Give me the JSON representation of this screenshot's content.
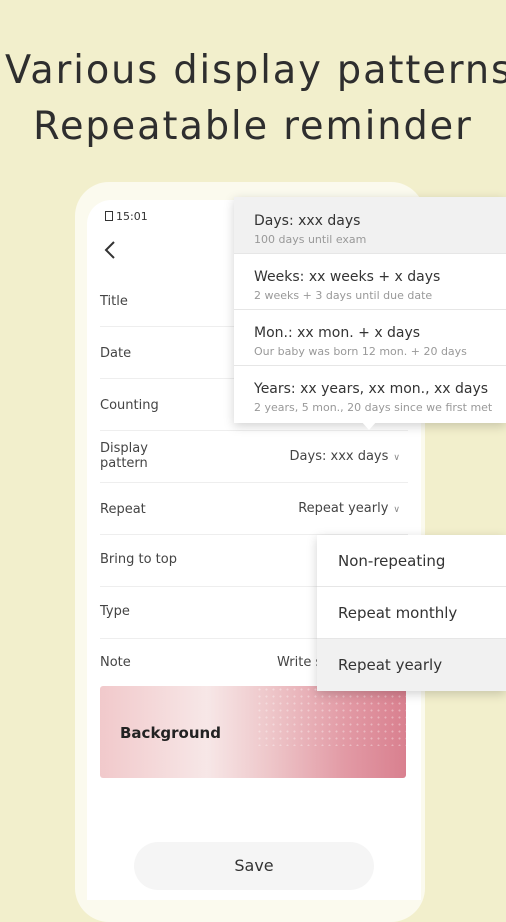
{
  "headline": {
    "line1": "Various display patterns",
    "line2": "Repeatable reminder"
  },
  "status_bar": {
    "time": "15:01"
  },
  "form": {
    "title_label": "Title",
    "date_label": "Date",
    "counting_label": "Counting",
    "display_pattern_label": "Display\npattern",
    "display_pattern_value": "Days: xxx days",
    "repeat_label": "Repeat",
    "repeat_value": "Repeat yearly",
    "bring_to_top_label": "Bring to top",
    "type_label": "Type",
    "note_label": "Note",
    "note_placeholder": "Write s",
    "background_label": "Background",
    "save_label": "Save"
  },
  "display_pattern_menu": [
    {
      "title": "Days: xxx days",
      "example": "100 days until exam",
      "selected": true
    },
    {
      "title": "Weeks: xx weeks + x days",
      "example": "2 weeks + 3 days until due date",
      "selected": false
    },
    {
      "title": "Mon.: xx mon. + x days",
      "example": "Our baby was born 12 mon. + 20 days",
      "selected": false
    },
    {
      "title": "Years: xx years, xx mon., xx days",
      "example": "2 years, 5 mon., 20 days since we first met",
      "selected": false
    }
  ],
  "repeat_menu": [
    {
      "label": "Non-repeating",
      "selected": false
    },
    {
      "label": "Repeat monthly",
      "selected": false
    },
    {
      "label": "Repeat yearly",
      "selected": true
    }
  ],
  "colors": {
    "page_background": "#f2efcc",
    "background_card_accent": "#d9808f"
  }
}
